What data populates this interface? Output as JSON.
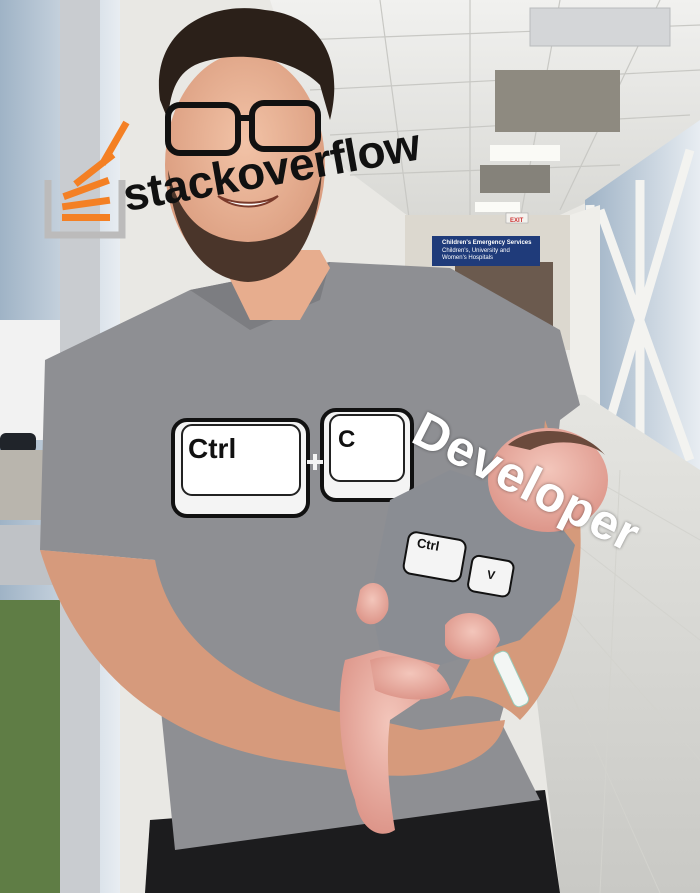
{
  "overlay": {
    "brand_text": "stackoverflow",
    "label_text": "Developer"
  },
  "shirt": {
    "big_key_1": "Ctrl",
    "big_key_2": "C",
    "small_key_1": "Ctrl",
    "small_key_2": "V"
  },
  "hallway_sign": {
    "line1": "Children's Emergency Services",
    "line2": "Children's, University and",
    "line3": "Women's Hospitals"
  },
  "exit_sign": "EXIT",
  "colors": {
    "logo_orange": "#F48024",
    "logo_gray": "#BCBBBB",
    "shirt_gray": "#8E8F93",
    "pants_black": "#1c1c1e"
  }
}
